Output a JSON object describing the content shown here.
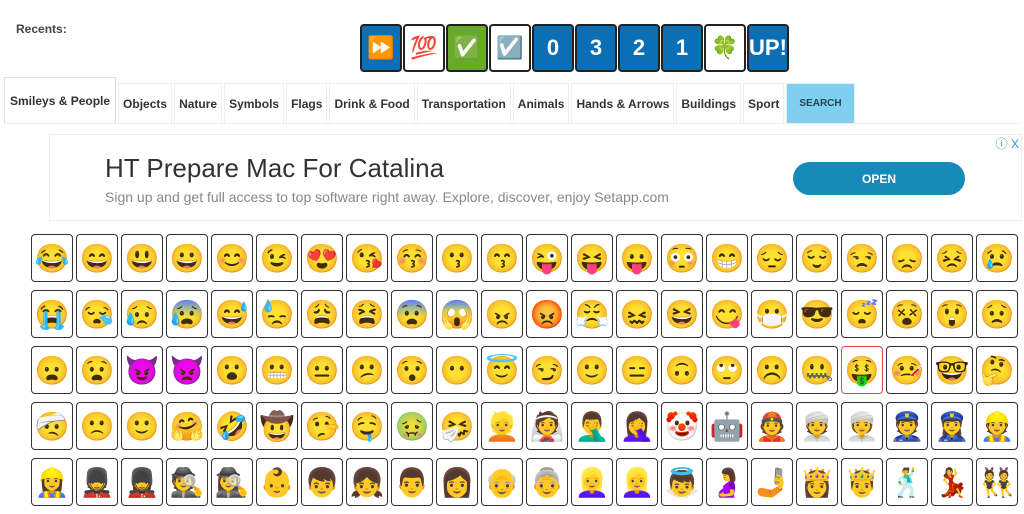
{
  "recents": {
    "label": "Recents:",
    "items": [
      "⏩",
      "💯",
      "✅",
      "☑️",
      "0",
      "3",
      "2",
      "1",
      "🍀",
      "UP!"
    ]
  },
  "tabs": [
    {
      "label": "Smileys & People",
      "active": true
    },
    {
      "label": "Objects"
    },
    {
      "label": "Nature"
    },
    {
      "label": "Symbols"
    },
    {
      "label": "Flags"
    },
    {
      "label": "Drink & Food"
    },
    {
      "label": "Transportation"
    },
    {
      "label": "Animals"
    },
    {
      "label": "Hands & Arrows"
    },
    {
      "label": "Buildings"
    },
    {
      "label": "Sport"
    },
    {
      "label": "SEARCH"
    }
  ],
  "ad": {
    "title": "HT Prepare Mac For Catalina",
    "subtitle": "Sign up and get full access to top software right away. Explore, discover, enjoy Setapp.com",
    "button": "OPEN",
    "close": "ⓘ X"
  },
  "emojis": [
    "😂",
    "😄",
    "😃",
    "😀",
    "😊",
    "😉",
    "😍",
    "😘",
    "😚",
    "😗",
    "😙",
    "😜",
    "😝",
    "😛",
    "😳",
    "😁",
    "😔",
    "😌",
    "😒",
    "😞",
    "😣",
    "😢",
    "😭",
    "😪",
    "😥",
    "😰",
    "😅",
    "😓",
    "😩",
    "😫",
    "😨",
    "😱",
    "😠",
    "😡",
    "😤",
    "😖",
    "😆",
    "😋",
    "😷",
    "😎",
    "😴",
    "😵",
    "😲",
    "😟",
    "😦",
    "😧",
    "😈",
    "👿",
    "😮",
    "😬",
    "😐",
    "😕",
    "😯",
    "😶",
    "😇",
    "😏",
    "🙂",
    "😑",
    "🙃",
    "🙄",
    "☹️",
    "🤐",
    "🤑",
    "🤒",
    "🤓",
    "🤔",
    "🤕",
    "🙁",
    "🙂",
    "🤗",
    "🤣",
    "🤠",
    "🤥",
    "🤤",
    "🤢",
    "🤧",
    "👱",
    "👰",
    "🤦‍♂️",
    "🤦‍♀️",
    "🤡",
    "🤖",
    "👲",
    "👳",
    "👳‍♀️",
    "👮",
    "👮‍♀️",
    "👷",
    "👷‍♀️",
    "💂",
    "💂‍♀️",
    "🕵️",
    "🕵️‍♀️",
    "👶",
    "👦",
    "👧",
    "👨",
    "👩",
    "👴",
    "👵",
    "👱‍♀️",
    "👱‍♀️",
    "👼",
    "🤰",
    "🤳",
    "👸",
    "🤴",
    "🕺",
    "💃",
    "👯"
  ]
}
